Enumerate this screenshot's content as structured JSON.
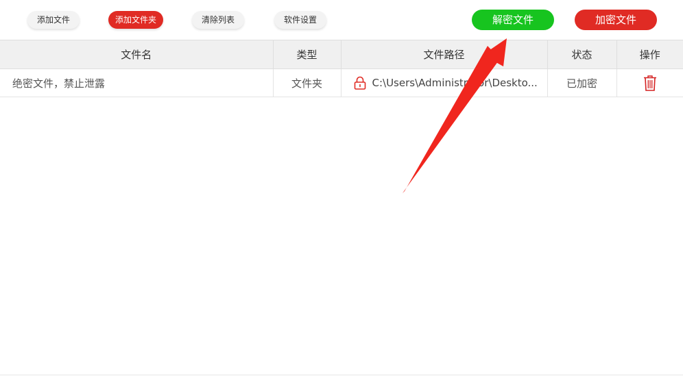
{
  "toolbar": {
    "add_file": "添加文件",
    "add_folder": "添加文件夹",
    "clear_list": "清除列表",
    "settings": "软件设置",
    "decrypt": "解密文件",
    "encrypt": "加密文件"
  },
  "colors": {
    "accent_red": "#e02b24",
    "accent_green": "#17c41f",
    "annotation_arrow": "#f0261e"
  },
  "table": {
    "headers": {
      "name": "文件名",
      "type": "类型",
      "path": "文件路径",
      "status": "状态",
      "action": "操作"
    },
    "rows": [
      {
        "name": "绝密文件，禁止泄露",
        "type": "文件夹",
        "path": "C:\\Users\\Administrator\\Deskto...",
        "path_icon": "lock-icon",
        "status": "已加密",
        "action_icon": "trash-icon"
      }
    ]
  }
}
